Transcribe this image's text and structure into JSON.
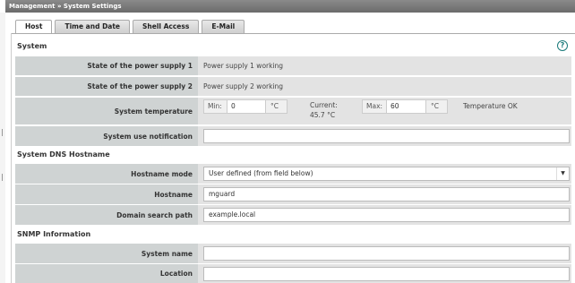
{
  "header": {
    "breadcrumb": "Management » System Settings"
  },
  "tabs": [
    {
      "label": "Host",
      "active": true
    },
    {
      "label": "Time and Date",
      "active": false
    },
    {
      "label": "Shell Access",
      "active": false
    },
    {
      "label": "E-Mail",
      "active": false
    }
  ],
  "help_glyph": "?",
  "sections": {
    "system": {
      "title": "System",
      "power_supply_1": {
        "label": "State of the power supply 1",
        "value": "Power supply 1 working"
      },
      "power_supply_2": {
        "label": "State of the power supply 2",
        "value": "Power supply 2 working"
      },
      "temperature": {
        "label": "System temperature",
        "min_label": "Min:",
        "min_value": "0",
        "min_unit": "°C",
        "current_label": "Current:",
        "current_value": "45.7 °C",
        "max_label": "Max:",
        "max_value": "60",
        "max_unit": "°C",
        "status": "Temperature OK"
      },
      "notification": {
        "label": "System use notification",
        "value": ""
      }
    },
    "dns": {
      "title": "System DNS Hostname",
      "hostname_mode": {
        "label": "Hostname mode",
        "value": "User defined (from field below)"
      },
      "hostname": {
        "label": "Hostname",
        "value": "mguard"
      },
      "domain_search_path": {
        "label": "Domain search path",
        "value": "example.local"
      }
    },
    "snmp": {
      "title": "SNMP Information",
      "system_name": {
        "label": "System name",
        "value": ""
      },
      "location": {
        "label": "Location",
        "value": ""
      }
    }
  },
  "colors": {
    "topbar": "#6b6b6b",
    "label_bg": "#cfd3d3",
    "row_bg": "#e3e3e3",
    "help_accent": "#1a7a7a"
  }
}
